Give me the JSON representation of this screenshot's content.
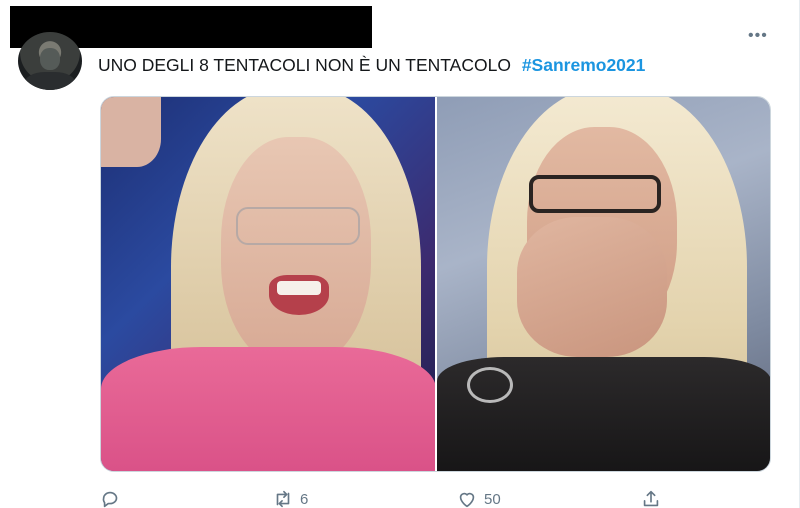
{
  "tweet": {
    "text": "UNO DEGLI 8 TENTACOLI NON È UN TENTACOLO",
    "hashtag": "#Sanremo2021",
    "more_label": "•••"
  },
  "media": {
    "photos": [
      {
        "description": "left-photo"
      },
      {
        "description": "right-photo"
      }
    ]
  },
  "actions": {
    "reply_icon": "reply-icon",
    "retweet_icon": "retweet-icon",
    "retweet_count": "6",
    "like_icon": "heart-icon",
    "like_count": "50",
    "share_icon": "share-icon"
  },
  "colors": {
    "text": "#14171a",
    "hashtag": "#1b95e0",
    "muted": "#657786",
    "border": "#ccd6dd"
  }
}
